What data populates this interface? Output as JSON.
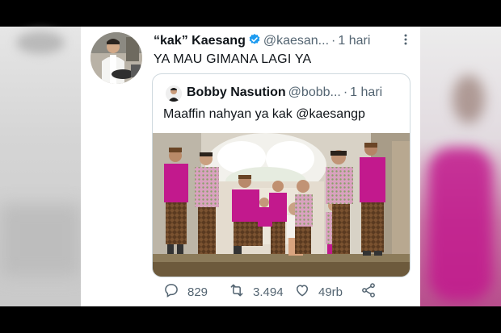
{
  "tweet": {
    "display_name": "“kak” Kaesang",
    "handle": "@kaesan...",
    "separator": "·",
    "time": "1 hari",
    "text": "YA MAU GIMANA LAGI YA",
    "avatar_icon": "profile-photo-chef",
    "verified_icon": "verified-badge-icon",
    "more_icon": "more-vertical-icon"
  },
  "quote": {
    "display_name": "Bobby Nasution",
    "handle": "@bobb...",
    "separator": "·",
    "time": "1 hari",
    "text": "Maaffin nahyan ya kak @kaesangp",
    "photo_icon": "family-group-photo"
  },
  "actions": {
    "reply_count": "829",
    "retweet_count": "3.494",
    "like_count": "49rb",
    "share_icon": "share-icon"
  },
  "colors": {
    "verified_blue": "#1d9bf0",
    "text_primary": "#0f1419",
    "text_secondary": "#536471",
    "magenta_outfit": "#c2198d"
  }
}
